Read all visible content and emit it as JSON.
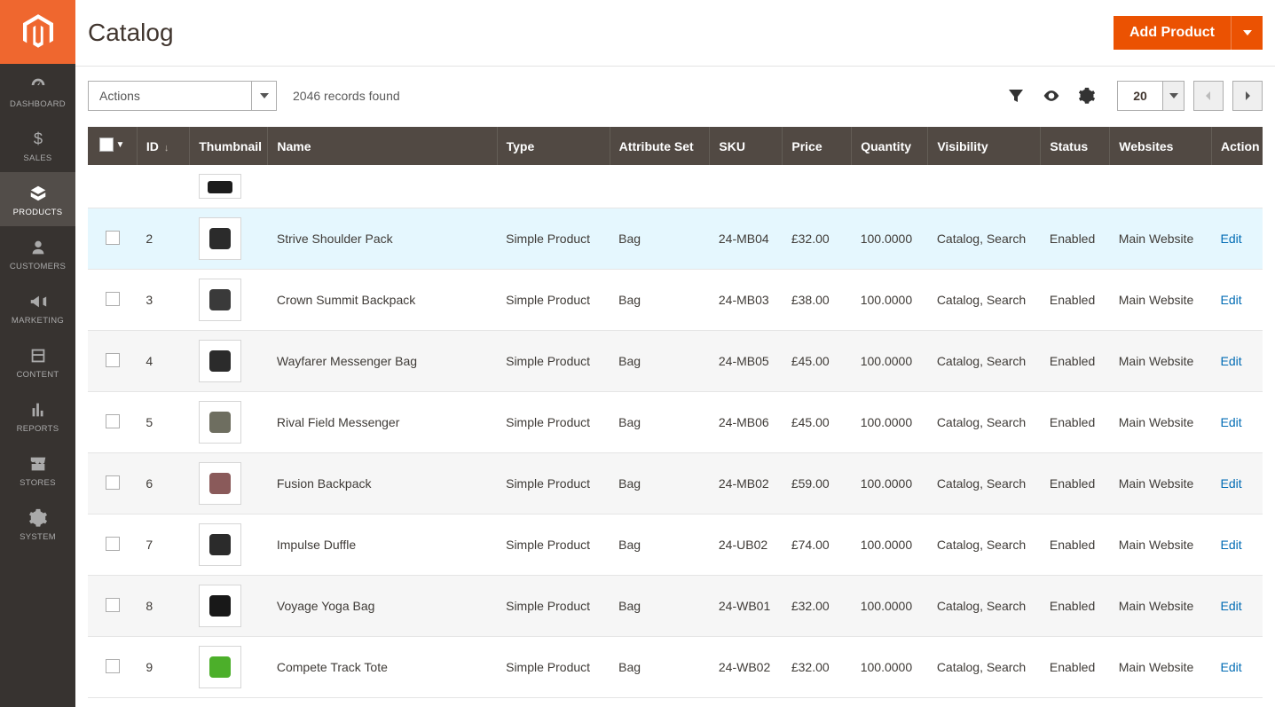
{
  "page": {
    "title": "Catalog"
  },
  "sidebar": {
    "items": [
      {
        "label": "DASHBOARD"
      },
      {
        "label": "SALES"
      },
      {
        "label": "PRODUCTS"
      },
      {
        "label": "CUSTOMERS"
      },
      {
        "label": "MARKETING"
      },
      {
        "label": "CONTENT"
      },
      {
        "label": "REPORTS"
      },
      {
        "label": "STORES"
      },
      {
        "label": "SYSTEM"
      }
    ]
  },
  "header": {
    "add_product_label": "Add Product"
  },
  "toolbar": {
    "actions_label": "Actions",
    "records_found": "2046 records found",
    "page_size": "20"
  },
  "columns": {
    "id": "ID",
    "thumbnail": "Thumbnail",
    "name": "Name",
    "type": "Type",
    "attribute_set": "Attribute Set",
    "sku": "SKU",
    "price": "Price",
    "quantity": "Quantity",
    "visibility": "Visibility",
    "status": "Status",
    "websites": "Websites",
    "action": "Action"
  },
  "action_label": "Edit",
  "rows": [
    {
      "id": "2",
      "name": "Strive Shoulder Pack",
      "type": "Simple Product",
      "attribute_set": "Bag",
      "sku": "24-MB04",
      "price": "£32.00",
      "quantity": "100.0000",
      "visibility": "Catalog, Search",
      "status": "Enabled",
      "websites": "Main Website",
      "thumb_color": "#2b2b2b"
    },
    {
      "id": "3",
      "name": "Crown Summit Backpack",
      "type": "Simple Product",
      "attribute_set": "Bag",
      "sku": "24-MB03",
      "price": "£38.00",
      "quantity": "100.0000",
      "visibility": "Catalog, Search",
      "status": "Enabled",
      "websites": "Main Website",
      "thumb_color": "#3a3a3a"
    },
    {
      "id": "4",
      "name": "Wayfarer Messenger Bag",
      "type": "Simple Product",
      "attribute_set": "Bag",
      "sku": "24-MB05",
      "price": "£45.00",
      "quantity": "100.0000",
      "visibility": "Catalog, Search",
      "status": "Enabled",
      "websites": "Main Website",
      "thumb_color": "#2b2b2b"
    },
    {
      "id": "5",
      "name": "Rival Field Messenger",
      "type": "Simple Product",
      "attribute_set": "Bag",
      "sku": "24-MB06",
      "price": "£45.00",
      "quantity": "100.0000",
      "visibility": "Catalog, Search",
      "status": "Enabled",
      "websites": "Main Website",
      "thumb_color": "#6e6e60"
    },
    {
      "id": "6",
      "name": "Fusion Backpack",
      "type": "Simple Product",
      "attribute_set": "Bag",
      "sku": "24-MB02",
      "price": "£59.00",
      "quantity": "100.0000",
      "visibility": "Catalog, Search",
      "status": "Enabled",
      "websites": "Main Website",
      "thumb_color": "#8a5a5a"
    },
    {
      "id": "7",
      "name": "Impulse Duffle",
      "type": "Simple Product",
      "attribute_set": "Bag",
      "sku": "24-UB02",
      "price": "£74.00",
      "quantity": "100.0000",
      "visibility": "Catalog, Search",
      "status": "Enabled",
      "websites": "Main Website",
      "thumb_color": "#2b2b2b"
    },
    {
      "id": "8",
      "name": "Voyage Yoga Bag",
      "type": "Simple Product",
      "attribute_set": "Bag",
      "sku": "24-WB01",
      "price": "£32.00",
      "quantity": "100.0000",
      "visibility": "Catalog, Search",
      "status": "Enabled",
      "websites": "Main Website",
      "thumb_color": "#181818"
    },
    {
      "id": "9",
      "name": "Compete Track Tote",
      "type": "Simple Product",
      "attribute_set": "Bag",
      "sku": "24-WB02",
      "price": "£32.00",
      "quantity": "100.0000",
      "visibility": "Catalog, Search",
      "status": "Enabled",
      "websites": "Main Website",
      "thumb_color": "#4caf2a"
    }
  ]
}
